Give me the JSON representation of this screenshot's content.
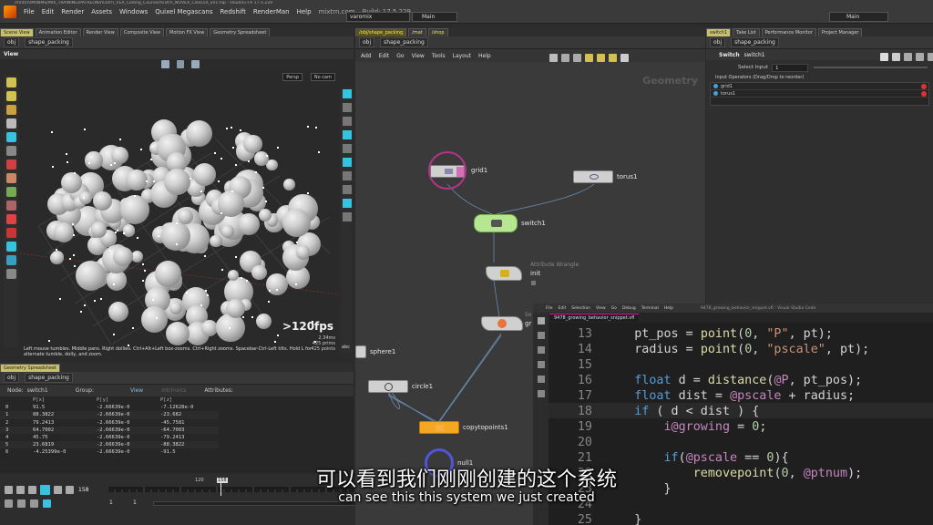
{
  "menubar": {
    "items": [
      "File",
      "Edit",
      "Render",
      "Assets",
      "Windows",
      "Quixel Megascans",
      "Redshift",
      "RenderMan",
      "Help"
    ],
    "site": "mixtrn.com",
    "build": "Build: 17.5.229",
    "path": "/mnt/m/MINIMS/MIX_TRAINING/PATREON/mixtrn_VEX_Coding_Course/mixtrn_NOVEX_Class10_v01.hip - Houdini FX 17.5.229",
    "desk_left": "varomix",
    "desk_mid": "Main",
    "desk_right": "Main"
  },
  "left_panel": {
    "tabs": [
      "Scene View",
      "Animation Editor",
      "Render View",
      "Composite View",
      "Motion FX View",
      "Geometry Spreadsheet"
    ],
    "path": [
      "obj",
      "shape_packing"
    ],
    "view_label": "View",
    "persp_btn": "Persp",
    "cam_btn": "No cam",
    "fps": ">120fps",
    "stats": [
      "2.34ms",
      "425 prims",
      "425 points"
    ],
    "abc_label": "abc",
    "help_text": "Left mouse tumbles. Middle pans. Right dollies. Ctrl+Alt+Left box-zooms. Ctrl+Right zooms. Spacebar-Ctrl-Left tilts. Hold L for alternate tumble, dolly, and zoom."
  },
  "spreadsheet": {
    "tab": "Geometry Spreadsheet",
    "path": [
      "obj",
      "shape_packing"
    ],
    "node_label": "Node:",
    "node_value": "switch1",
    "group_label": "Group:",
    "view_btn": "View",
    "intrinsics_label": "Intrinsics",
    "attributes_label": "Attributes:",
    "columns": [
      "",
      "P[x]",
      "P[y]",
      "P[z]"
    ],
    "rows": [
      [
        "0",
        "91.5",
        "-2.66639e-0",
        "-7.12628e-0"
      ],
      [
        "1",
        "88.3822",
        "-2.66639e-0",
        "-23.682"
      ],
      [
        "2",
        "79.2413",
        "-2.66639e-0",
        "-45.7581"
      ],
      [
        "3",
        "64.7002",
        "-2.66639e-0",
        "-64.7003"
      ],
      [
        "4",
        "45.75",
        "-2.66639e-0",
        "-79.2413"
      ],
      [
        "5",
        "23.6819",
        "-2.66639e-0",
        "-88.3822"
      ],
      [
        "6",
        "-4.25399e-0",
        "-2.66639e-0",
        "-91.5"
      ]
    ]
  },
  "timeline": {
    "frame": "158",
    "ticks": [
      "120",
      "158"
    ],
    "range_start": "1",
    "range_start2": "1"
  },
  "network": {
    "tabs": [
      "/obj/shape_packing",
      "/mat",
      "/shop"
    ],
    "path": [
      "obj",
      "shape_packing"
    ],
    "menu": [
      "Add",
      "Edit",
      "Go",
      "View",
      "Tools",
      "Layout",
      "Help"
    ],
    "context": "Geometry",
    "nodes": {
      "grid1": "grid1",
      "torus1": "torus1",
      "switch1": "switch1",
      "wrangle_type": "Attribute Wrangle",
      "init": "init",
      "sop_partial": "So",
      "sop_partial2": "gr",
      "sphere1": "sphere1",
      "circle1": "circle1",
      "copytopoints1": "copytopoints1",
      "null_partial": "null1"
    }
  },
  "params": {
    "tabs": [
      "switch1",
      "Take List",
      "Performance Monitor",
      "Project Manager"
    ],
    "path": [
      "obj",
      "shape_packing"
    ],
    "node_type": "Switch",
    "node_name": "switch1",
    "select_input_label": "Select Input",
    "select_input_value": "1",
    "operators_label": "Input Operators (Drag/Drop to reorder)",
    "operators": [
      "grid1",
      "torus1"
    ]
  },
  "editor": {
    "menu": [
      "File",
      "Edit",
      "Selection",
      "View",
      "Go",
      "Debug",
      "Terminal",
      "Help"
    ],
    "filename": "9478_growing_behavior_snippet.vfl",
    "title_right": "9478_growing_behavior_snippet.vfl - Visual Studio Code",
    "lines": [
      {
        "n": "13",
        "code": "    pt_pos = point(0, \"P\", pt);"
      },
      {
        "n": "14",
        "code": "    radius = point(0, \"pscale\", pt);"
      },
      {
        "n": "15",
        "code": ""
      },
      {
        "n": "16",
        "code": "    float d = distance(@P, pt_pos);"
      },
      {
        "n": "17",
        "code": "    float dist = @pscale + radius;"
      },
      {
        "n": "18",
        "code": "    if ( d < dist ) {"
      },
      {
        "n": "19",
        "code": "        i@growing = 0;"
      },
      {
        "n": "20",
        "code": ""
      },
      {
        "n": "21",
        "code": "        if(@pscale == 0){"
      },
      {
        "n": "22",
        "code": "            removepoint(0, @ptnum);"
      },
      {
        "n": "23",
        "code": "        }"
      },
      {
        "n": "24",
        "code": ""
      },
      {
        "n": "25",
        "code": "    }"
      }
    ]
  },
  "subtitles": {
    "zh": "可以看到我们刚刚创建的这个系统",
    "en": "can see this this system we just created"
  },
  "colors": {
    "accent": "#c9c06c",
    "node_selected": "#b7e690",
    "copy_node": "#f5a623",
    "grid_ring": "#b5338a",
    "code_bg": "#1f1f1f"
  }
}
